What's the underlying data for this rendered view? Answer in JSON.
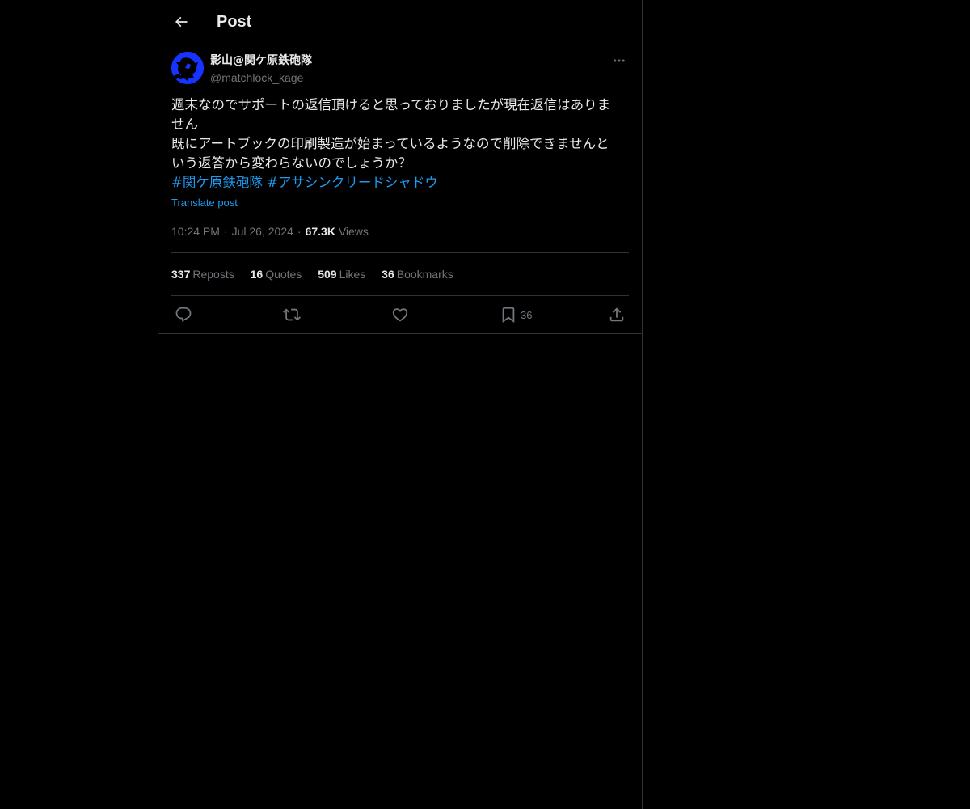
{
  "header": {
    "title": "Post",
    "back_icon": "arrow-left-icon"
  },
  "author": {
    "display_name": "影山@関ケ原鉄砲隊",
    "handle": "@matchlock_kage",
    "avatar_color": "#1733ff"
  },
  "post": {
    "lines": [
      "週末なのでサポートの返信頂けると思っておりましたが現在返信はありま",
      "せん",
      "既にアートブックの印刷製造が始まっているようなので削除できませんと",
      "いう返答から変わらないのでしょうか？"
    ],
    "hashtags": [
      "#関ケ原鉄砲隊",
      "#アサシンクリードシャドウ"
    ],
    "translate_label": "Translate post"
  },
  "meta": {
    "time": "10:24 PM",
    "date": "Jul 26, 2024",
    "views_count": "67.3K",
    "views_label": "Views",
    "separator": "·"
  },
  "stats": {
    "reposts": {
      "count": "337",
      "label": "Reposts"
    },
    "quotes": {
      "count": "16",
      "label": "Quotes"
    },
    "likes": {
      "count": "509",
      "label": "Likes"
    },
    "bookmarks": {
      "count": "36",
      "label": "Bookmarks"
    }
  },
  "actions": {
    "reply_icon": "reply-icon",
    "repost_icon": "repost-icon",
    "like_icon": "heart-icon",
    "bookmark_icon": "bookmark-icon",
    "bookmark_count": "36",
    "share_icon": "share-icon"
  },
  "colors": {
    "background": "#000000",
    "text": "#e7e9ea",
    "secondary": "#71767b",
    "accent": "#1d9bf0",
    "border": "#2f3336"
  }
}
